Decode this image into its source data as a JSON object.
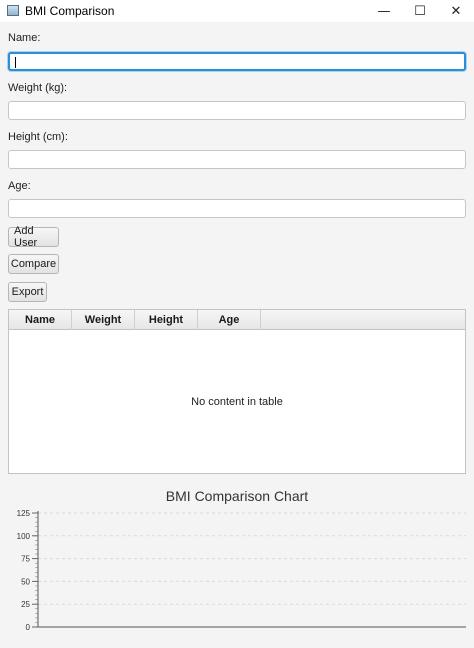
{
  "window": {
    "title": "BMI Comparison",
    "icon": "app-window-icon",
    "controls": {
      "minimize": "—",
      "maximize": "☐",
      "close": "✕"
    }
  },
  "form": {
    "name_label": "Name:",
    "name_value": "",
    "weight_label": "Weight (kg):",
    "weight_value": "",
    "height_label": "Height (cm):",
    "height_value": "",
    "age_label": "Age:",
    "age_value": ""
  },
  "buttons": {
    "add_user": "Add User",
    "compare": "Compare",
    "export": "Export"
  },
  "table": {
    "columns": [
      "Name",
      "Weight",
      "Height",
      "Age"
    ],
    "rows": [],
    "empty_text": "No content in table"
  },
  "chart_data": {
    "type": "bar",
    "title": "BMI Comparison Chart",
    "categories": [],
    "series": [],
    "xlabel": "",
    "ylabel": "",
    "ylim": [
      0,
      125
    ],
    "yticks": [
      0,
      25,
      50,
      75,
      100,
      125
    ],
    "grid": true,
    "grid_color": "#d9d9d9"
  },
  "colors": {
    "focus_border": "#2a8fd6",
    "background": "#f4f4f4"
  }
}
